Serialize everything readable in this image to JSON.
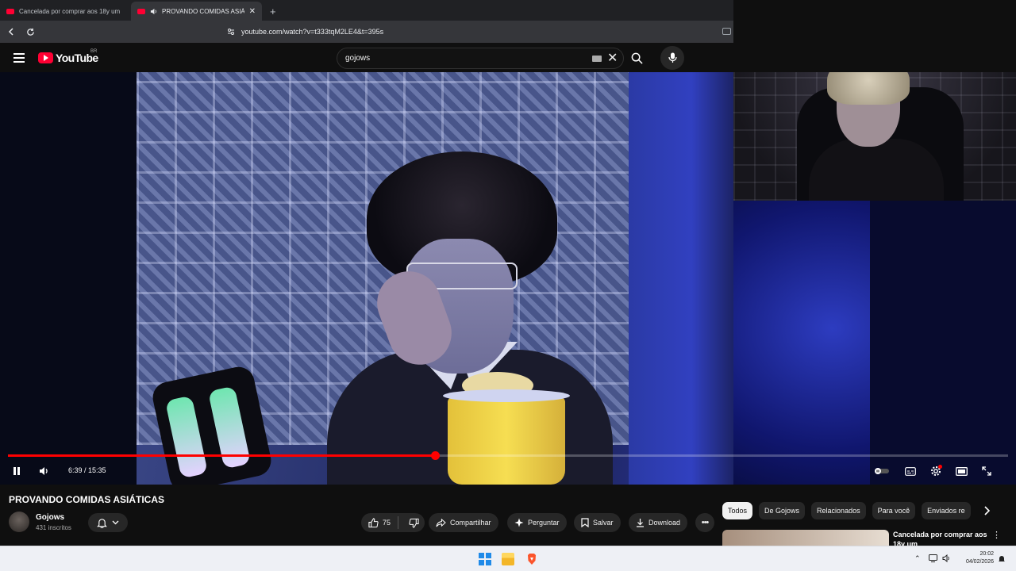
{
  "browser": {
    "tabs": [
      {
        "title": "Cancelada por comprar aos 18y um",
        "active": false
      },
      {
        "title": "PROVANDO COMIDAS ASIÁTI",
        "active": true
      }
    ],
    "url": "youtube.com/watch?v=t333tqM2LE4&t=395s"
  },
  "youtube": {
    "logo_text": "YouTube",
    "logo_region": "BR",
    "search_value": "gojows"
  },
  "player": {
    "current_time": "6:39",
    "duration": "15:35",
    "time_text": "6:39 / 15:35",
    "progress_fraction": 0.427
  },
  "video": {
    "title": "PROVANDO COMIDAS ASIÁTICAS",
    "channel": "Gojows",
    "subscribers": "431 inscritos",
    "likes": "75"
  },
  "actions": {
    "share": "Compartilhar",
    "ask": "Perguntar",
    "save": "Salvar",
    "download": "Download"
  },
  "chips": [
    "Todos",
    "De Gojows",
    "Relacionados",
    "Para você",
    "Enviados re"
  ],
  "recommendation": {
    "title": "Cancelada por comprar aos 18y um"
  },
  "taskbar": {
    "time": "20:02",
    "date": "04/02/2026"
  },
  "colors": {
    "youtube_red": "#ff0033",
    "progress_red": "#ff0000",
    "background": "#0f0f0f"
  }
}
